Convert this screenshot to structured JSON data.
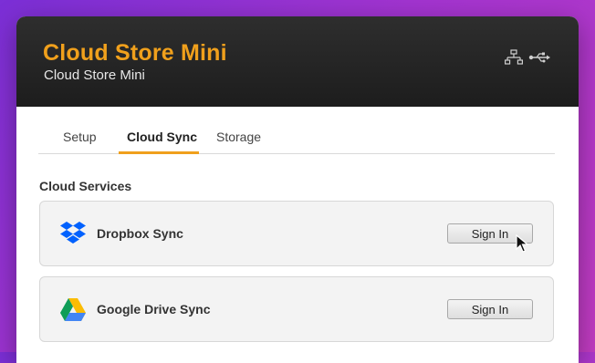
{
  "app": {
    "title": "Cloud Store Mini",
    "subtitle": "Cloud Store Mini",
    "header_icons": [
      "network-icon",
      "usb-icon"
    ]
  },
  "tabs": [
    {
      "label": "Setup",
      "active": false
    },
    {
      "label": "Cloud Sync",
      "active": true
    },
    {
      "label": "Storage",
      "active": false
    }
  ],
  "section": {
    "title": "Cloud Services"
  },
  "services": [
    {
      "name": "Dropbox Sync",
      "icon": "dropbox-icon",
      "button_label": "Sign In"
    },
    {
      "name": "Google Drive Sync",
      "icon": "google-drive-icon",
      "button_label": "Sign In"
    }
  ],
  "colors": {
    "accent": "#f0a01c",
    "header_bg": "#1f1f1f",
    "dropbox_blue": "#0061fe",
    "background_start": "#7b2fd6",
    "background_end": "#c23cc2"
  }
}
